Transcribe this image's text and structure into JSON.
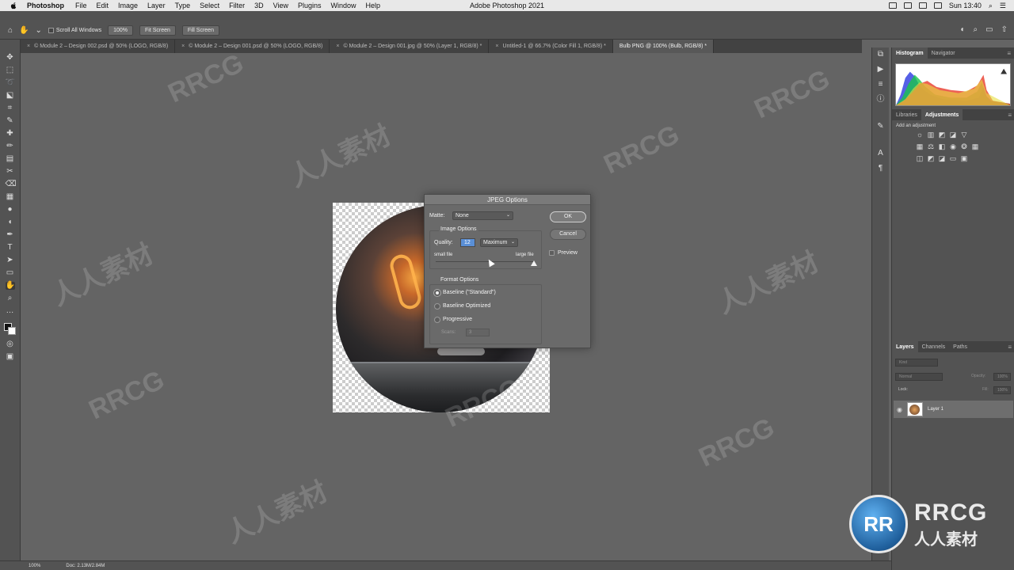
{
  "menubar": {
    "app": "Photoshop",
    "items": [
      "File",
      "Edit",
      "Image",
      "Layer",
      "Type",
      "Select",
      "Filter",
      "3D",
      "View",
      "Plugins",
      "Window",
      "Help"
    ],
    "window_title": "Adobe Photoshop 2021",
    "clock": "Sun 13:40"
  },
  "optionsbar": {
    "scroll_all_windows": "Scroll All Windows",
    "zoom_100": "100%",
    "fit_screen": "Fit Screen",
    "fill_screen": "Fill Screen"
  },
  "tabs": [
    {
      "label": "© Module 2 – Design 002.psd @ 50% (LOGO, RGB/8)",
      "active": false
    },
    {
      "label": "© Module 2 – Design 001.psd @ 50% (LOGO, RGB/8)",
      "active": false
    },
    {
      "label": "© Module 2 – Design 001.jpg @ 50% (Layer 1, RGB/8) *",
      "active": false
    },
    {
      "label": "Untitled-1 @ 66.7% (Color Fill 1, RGB/8) *",
      "active": false
    },
    {
      "label": "Bulb PNG @ 100% (Bulb, RGB/8) *",
      "active": true
    }
  ],
  "dialog": {
    "title": "JPEG Options",
    "matte_label": "Matte:",
    "matte_value": "None",
    "image_options_label": "Image Options",
    "quality_label": "Quality:",
    "quality_value": "12",
    "quality_preset": "Maximum",
    "small_file": "small file",
    "large_file": "large file",
    "quality_level_fraction": 1.0,
    "format_options_label": "Format Options",
    "format_baseline_standard": "Baseline (\"Standard\")",
    "format_baseline_optimized": "Baseline Optimized",
    "format_progressive": "Progressive",
    "scans_label": "Scans:",
    "scans_value": "3",
    "ok": "OK",
    "cancel": "Cancel",
    "preview": "Preview"
  },
  "panels": {
    "top_tabs": [
      "Histogram",
      "Navigator"
    ],
    "mid_tabs": [
      "Libraries",
      "Adjustments"
    ],
    "add_adjustment": "Add an adjustment",
    "layer_tabs": [
      "Layers",
      "Channels",
      "Paths"
    ],
    "kind": "Kind",
    "blend_mode": "Normal",
    "opacity": "Opacity:",
    "opacity_value": "100%",
    "lock": "Lock:",
    "fill": "Fill:",
    "fill_value": "100%",
    "layer_name": "Layer 1"
  },
  "statusbar": {
    "zoom": "100%",
    "doc_info": "Doc: 2.13M/2.84M"
  },
  "watermark": {
    "text_latin": "RRCG",
    "text_cjk": "人人素材"
  },
  "colors": {
    "accent_selection": "#5a8fd6",
    "panel_bg": "#535353",
    "canvas_bg": "#646464"
  }
}
